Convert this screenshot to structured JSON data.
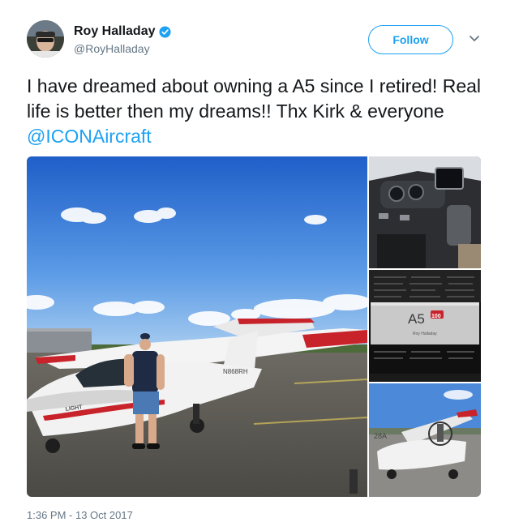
{
  "user": {
    "name": "Roy Halladay",
    "handle": "@RoyHalladay",
    "verified": true
  },
  "follow_label": "Follow",
  "tweet": {
    "text": "I have dreamed about owning a A5 since I retired! Real life is better then my dreams!! Thx Kirk & everyone ",
    "mention": "@ICONAircraft"
  },
  "photos": {
    "main": {
      "brand": "LIGHT",
      "tail_number": "N868RH"
    },
    "plaque": {
      "model": "A5",
      "badge": "100",
      "owner": "Roy Halladay"
    },
    "hangar": {
      "tail_number": "28A"
    }
  },
  "timestamp": "1:36 PM - 13 Oct 2017",
  "icons": {
    "verified": "verified-badge-icon",
    "caret": "chevron-down-icon"
  },
  "colors": {
    "accent": "#1da1f2",
    "text": "#14171a",
    "secondary": "#657786"
  }
}
